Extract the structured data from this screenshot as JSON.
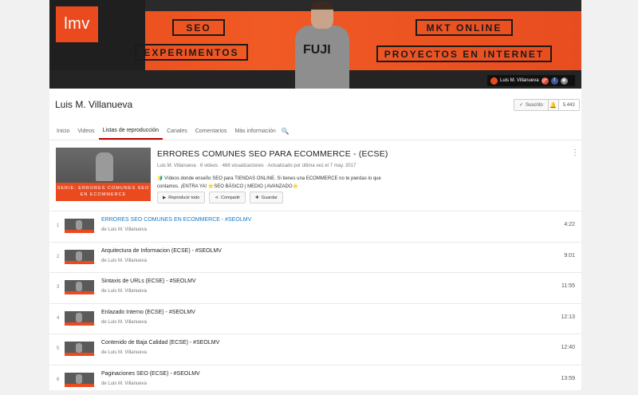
{
  "banner": {
    "logo_text": "lmv",
    "tags": [
      "SEO",
      "EXPERIMENTOS",
      "MKT ONLINE",
      "PROYECTOS EN INTERNET"
    ],
    "shirt_text": "FUJI",
    "badge_name": "Luis M. Villanueva",
    "social": [
      "g+",
      "f",
      "◉"
    ],
    "accent": "#ea4a1e"
  },
  "header": {
    "channel_name": "Luis M. Villanueva",
    "subscribe_label": "Suscrito",
    "subscriber_count": "5.443"
  },
  "tabs": [
    "Inicio",
    "Videos",
    "Listas de reproducción",
    "Canales",
    "Comentarios",
    "Más información"
  ],
  "playlist": {
    "title": "ERRORES COMUNES SEO PARA ECOMMERCE - (ECSE)",
    "author": "Luis M. Villanueva",
    "videos": "6 videos",
    "views": "466 visualizaciones",
    "updated": "Actualizado por última vez el 7 may. 2017",
    "description_1": "🔰 Vídeos donde enseño SEO para TIENDAS ONLINE. Si tienes una ECOMMERCE no te pierdas lo que",
    "description_2": "contamos. ¡ENTRA YA! ⭐SEO BÁSICO | MEDIO | AVANZADO⭐",
    "thumb_caption": "SERIE: ERRORES COMUNES SEO EN ECOMMERCE",
    "play_all": "Reproducir todo",
    "share": "Compartir",
    "save": "Guardar"
  },
  "videos": [
    {
      "index": "1",
      "title": "ERRORES SEO COMUNES EN ECOMMERCE - #SEOLMV",
      "by": "de Luis M. Villanueva",
      "duration": "4:22"
    },
    {
      "index": "2",
      "title": "Arquitectura de Informacion (ECSE) - #SEOLMV",
      "by": "de Luis M. Villanueva",
      "duration": "9:01"
    },
    {
      "index": "3",
      "title": "Sintaxis de URLs (ECSE) - #SEOLMV",
      "by": "de Luis M. Villanueva",
      "duration": "11:55"
    },
    {
      "index": "4",
      "title": "Enlazado Interno (ECSE) - #SEOLMV",
      "by": "de Luis M. Villanueva",
      "duration": "12:13"
    },
    {
      "index": "5",
      "title": "Contenido de Baja Calidad (ECSE) - #SEOLMV",
      "by": "de Luis M. Villanueva",
      "duration": "12:40"
    },
    {
      "index": "6",
      "title": "Paginaciones SEO (ECSE) - #SEOLMV",
      "by": "de Luis M. Villanueva",
      "duration": "13:59"
    }
  ]
}
